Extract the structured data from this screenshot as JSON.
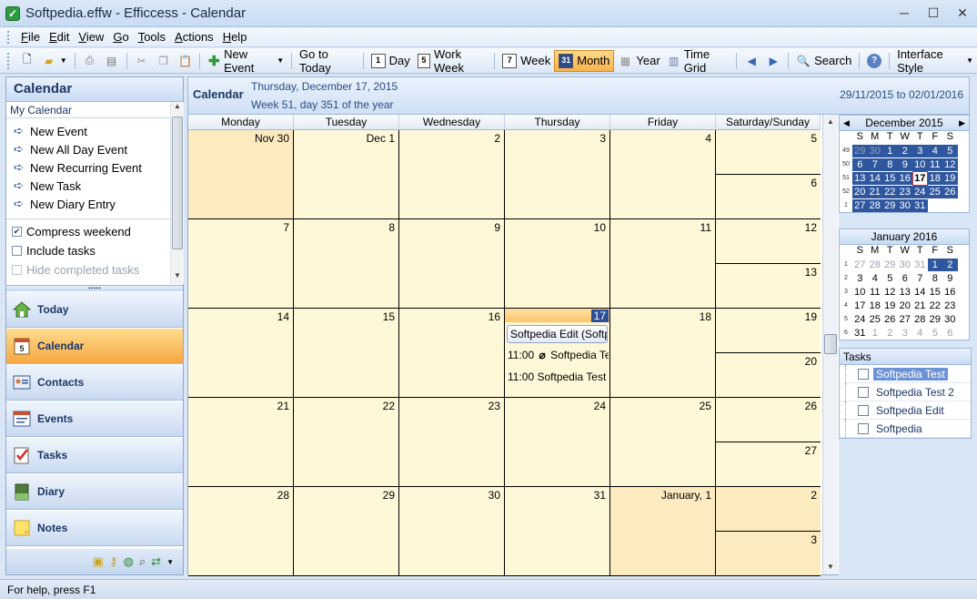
{
  "window": {
    "title": "Softpedia.effw - Efficcess - Calendar"
  },
  "menu": [
    "File",
    "Edit",
    "View",
    "Go",
    "Tools",
    "Actions",
    "Help"
  ],
  "toolbar": {
    "new_event": "New Event",
    "go_today": "Go to Today",
    "day": "Day",
    "work_week": "Work Week",
    "week": "Week",
    "month": "Month",
    "year": "Year",
    "time_grid": "Time Grid",
    "search": "Search",
    "interface_style": "Interface Style",
    "day_icon": "1",
    "work_week_icon": "5",
    "week_icon": "7",
    "month_icon": "31"
  },
  "left_panel": {
    "title": "Calendar",
    "section": "My Calendar",
    "tasks": [
      "New Event",
      "New All Day Event",
      "New Recurring Event",
      "New Task",
      "New Diary Entry"
    ],
    "options": [
      {
        "label": "Compress weekend",
        "checked": true,
        "disabled": false
      },
      {
        "label": "Include tasks",
        "checked": false,
        "disabled": false
      },
      {
        "label": "Hide completed tasks",
        "checked": false,
        "disabled": true
      }
    ],
    "nav": [
      "Today",
      "Calendar",
      "Contacts",
      "Events",
      "Tasks",
      "Diary",
      "Notes"
    ],
    "active_nav": "Calendar"
  },
  "calendar_header": {
    "title": "Calendar",
    "date": "Thursday, December 17, 2015",
    "week_info": "Week 51, day 351 of the year",
    "range": "29/11/2015 to 02/01/2016"
  },
  "days_of_week": [
    "Monday",
    "Tuesday",
    "Wednesday",
    "Thursday",
    "Friday",
    "Saturday/Sunday"
  ],
  "weeks": [
    {
      "days": [
        "Nov 30",
        "Dec 1",
        "2",
        "3",
        "4"
      ],
      "sat": "5",
      "sun": "6"
    },
    {
      "days": [
        "7",
        "8",
        "9",
        "10",
        "11"
      ],
      "sat": "12",
      "sun": "13"
    },
    {
      "days": [
        "14",
        "15",
        "16",
        "17",
        "18"
      ],
      "sat": "19",
      "sun": "20"
    },
    {
      "days": [
        "21",
        "22",
        "23",
        "24",
        "25"
      ],
      "sat": "26",
      "sun": "27"
    },
    {
      "days": [
        "28",
        "29",
        "30",
        "31",
        "January, 1"
      ],
      "sat": "2",
      "sun": "3"
    }
  ],
  "events": {
    "all_day": "Softpedia Edit (Softpe",
    "timed": [
      {
        "time": "11:00",
        "title": "Softpedia Te",
        "attachment": true
      },
      {
        "time": "11:00",
        "title": "Softpedia Test (",
        "attachment": false
      }
    ]
  },
  "mini_dec": {
    "title": "December 2015",
    "dow": [
      "S",
      "M",
      "T",
      "W",
      "T",
      "F",
      "S"
    ],
    "weeks": [
      "49",
      "50",
      "51",
      "52",
      "1"
    ],
    "rows": [
      [
        "29",
        "30",
        "1",
        "2",
        "3",
        "4",
        "5"
      ],
      [
        "6",
        "7",
        "8",
        "9",
        "10",
        "11",
        "12"
      ],
      [
        "13",
        "14",
        "15",
        "16",
        "17",
        "18",
        "19"
      ],
      [
        "20",
        "21",
        "22",
        "23",
        "24",
        "25",
        "26"
      ],
      [
        "27",
        "28",
        "29",
        "30",
        "31",
        "",
        ""
      ]
    ]
  },
  "mini_jan": {
    "title": "January 2016",
    "dow": [
      "S",
      "M",
      "T",
      "W",
      "T",
      "F",
      "S"
    ],
    "weeks": [
      "1",
      "2",
      "3",
      "4",
      "5",
      "6"
    ],
    "rows": [
      [
        "27",
        "28",
        "29",
        "30",
        "31",
        "1",
        "2"
      ],
      [
        "3",
        "4",
        "5",
        "6",
        "7",
        "8",
        "9"
      ],
      [
        "10",
        "11",
        "12",
        "13",
        "14",
        "15",
        "16"
      ],
      [
        "17",
        "18",
        "19",
        "20",
        "21",
        "22",
        "23"
      ],
      [
        "24",
        "25",
        "26",
        "27",
        "28",
        "29",
        "30"
      ],
      [
        "31",
        "1",
        "2",
        "3",
        "4",
        "5",
        "6"
      ]
    ]
  },
  "tasks_panel": {
    "title": "Tasks",
    "items": [
      "Softpedia Test",
      "Softpedia Test 2",
      "Softpedia Edit",
      "Softpedia"
    ]
  },
  "status": {
    "text": "For help, press F1"
  },
  "colors": {
    "accent": "#2f579f",
    "today_bg": "#f7a740",
    "cell_bg": "#fff8d8",
    "shade_bg": "#fdebc0"
  }
}
